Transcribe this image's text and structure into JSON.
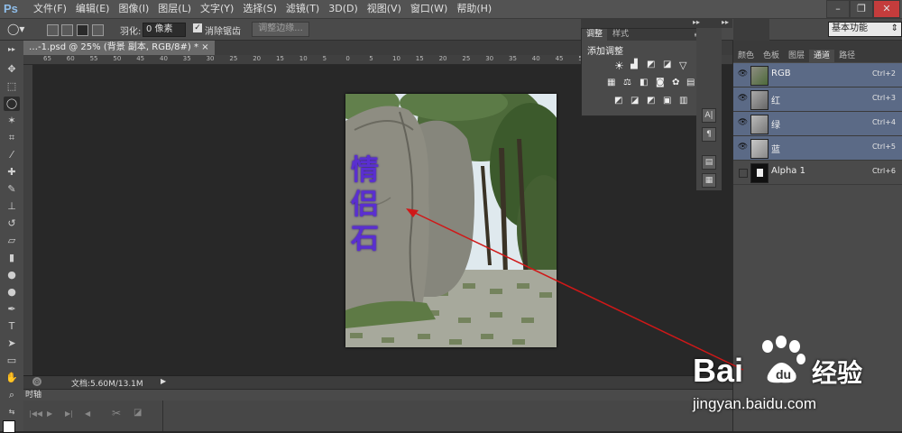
{
  "app": {
    "logo": "Ps"
  },
  "menu": [
    "文件(F)",
    "编辑(E)",
    "图像(I)",
    "图层(L)",
    "文字(Y)",
    "选择(S)",
    "滤镜(T)",
    "3D(D)",
    "视图(V)",
    "窗口(W)",
    "帮助(H)"
  ],
  "window_controls": {
    "minimize": "–",
    "restore": "❐",
    "close": "✕"
  },
  "options": {
    "feather_label": "羽化:",
    "feather_value": "0 像素",
    "antialias_label": "消除锯齿",
    "antialias_checked": true,
    "refine_edge": "调整边缘..."
  },
  "workspace": {
    "label": "基本功能"
  },
  "document": {
    "tab_title": "…-1.psd @ 25% (背景 副本, RGB/8#) *",
    "close": "×",
    "status_text": "文档:5.60M/13.1M"
  },
  "ruler_labels": [
    "65",
    "60",
    "55",
    "50",
    "45",
    "40",
    "35",
    "30",
    "25",
    "20",
    "15",
    "10",
    "5",
    "0",
    "5",
    "10",
    "15",
    "20",
    "25",
    "30",
    "35",
    "40",
    "45",
    "50"
  ],
  "photo_text": [
    "情",
    "侣",
    "石"
  ],
  "timeline": {
    "label": "时轴"
  },
  "adjustments": {
    "tab_adjust": "调整",
    "tab_style": "样式",
    "title": "添加调整"
  },
  "channels_panel": {
    "tabs": [
      {
        "label": "颜色",
        "active": false
      },
      {
        "label": "色板",
        "active": false
      },
      {
        "label": "图层",
        "active": false
      },
      {
        "label": "通道",
        "active": true
      },
      {
        "label": "路径",
        "active": false
      }
    ],
    "channels": [
      {
        "name": "RGB",
        "shortcut": "Ctrl+2",
        "visible": true,
        "selected": true
      },
      {
        "name": "红",
        "shortcut": "Ctrl+3",
        "visible": true,
        "selected": true
      },
      {
        "name": "绿",
        "shortcut": "Ctrl+4",
        "visible": true,
        "selected": true
      },
      {
        "name": "蓝",
        "shortcut": "Ctrl+5",
        "visible": true,
        "selected": true
      },
      {
        "name": "Alpha 1",
        "shortcut": "Ctrl+6",
        "visible": false,
        "selected": false
      }
    ]
  },
  "watermark": {
    "brand": "Bai",
    "brand_cn": "经验",
    "url": "jingyan.baidu.com"
  },
  "colors": {
    "selection": "#5b6a86",
    "accent_arrow": "#d01818",
    "calligraphy": "#5a2fd0"
  }
}
